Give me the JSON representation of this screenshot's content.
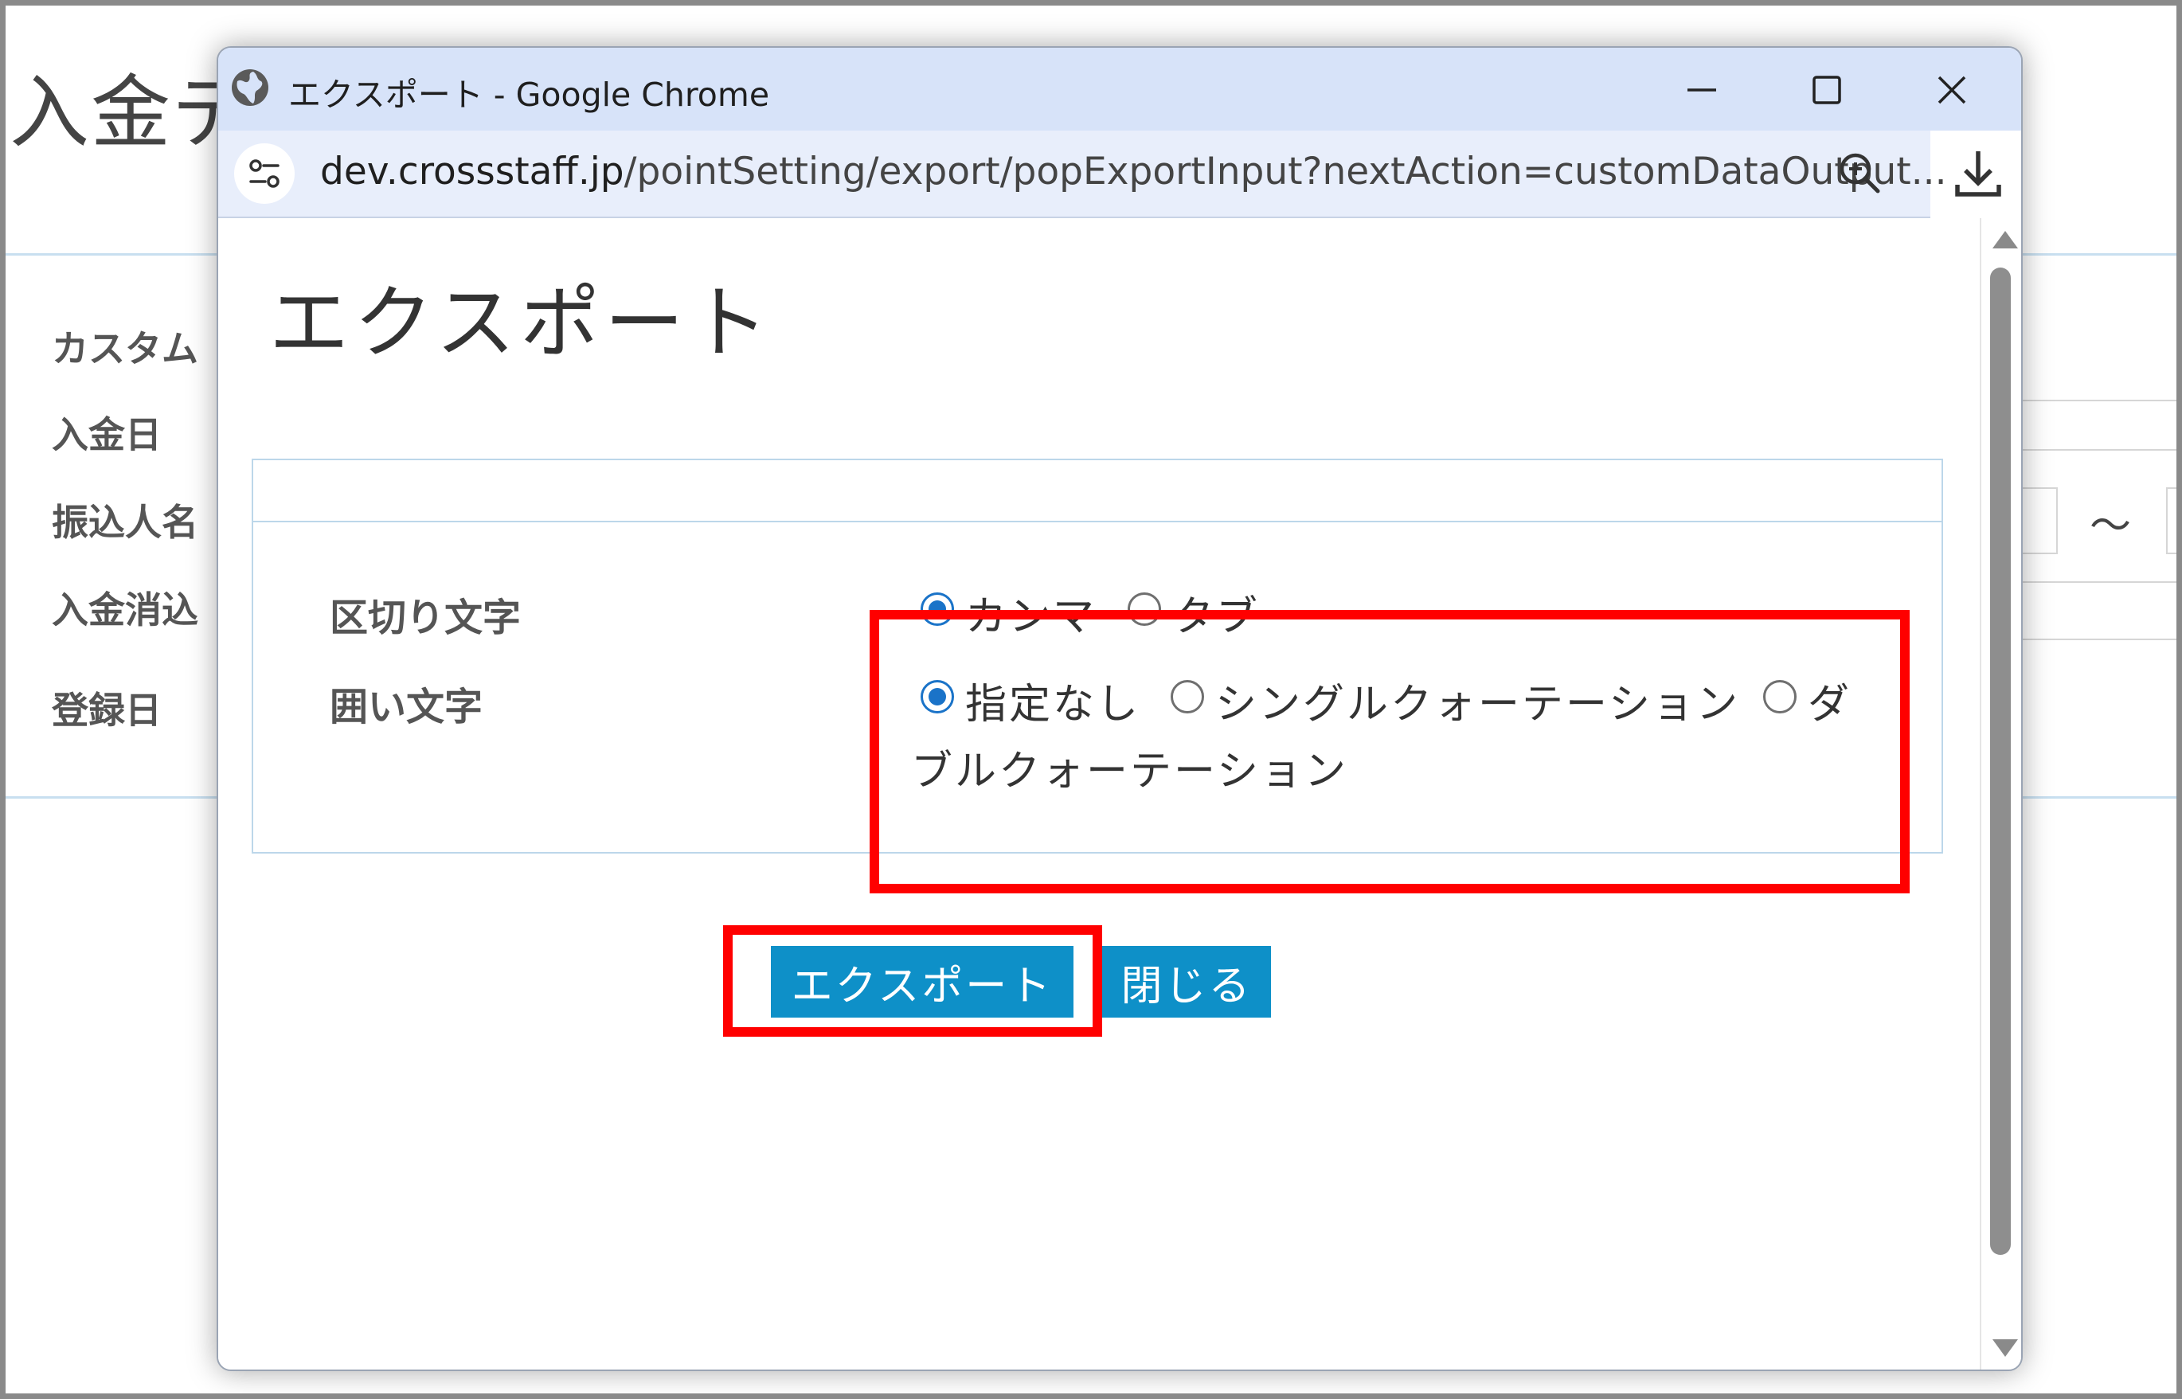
{
  "background_page": {
    "title": "入金デ",
    "labels": [
      "カスタム",
      "入金日",
      "振込人名",
      "入金消込",
      "登録日"
    ],
    "range_separator": "～"
  },
  "popup": {
    "window_title": "エクスポート - Google Chrome",
    "url_host": "dev.crossstaff.jp",
    "url_path": "/pointSetting/export/popExportInput?nextAction=customDataOutput...",
    "heading": "エクスポート",
    "fields": {
      "delimiter": {
        "label": "区切り文字",
        "options": [
          "カンマ",
          "タブ"
        ],
        "selected": "カンマ"
      },
      "enclosure": {
        "label": "囲い文字",
        "options": [
          "指定なし",
          "シングルクォーテーション",
          "ダブルクォーテーション"
        ],
        "option_lines": [
          "ダ",
          "ブルクォーテーション"
        ],
        "selected": "指定なし"
      }
    },
    "buttons": {
      "export": "エクスポート",
      "close": "閉じる"
    }
  },
  "colors": {
    "button": "#0e90c8",
    "highlight": "#ff0000",
    "titlebar": "#d7e3f9",
    "radio_checked": "#1a73c8"
  }
}
